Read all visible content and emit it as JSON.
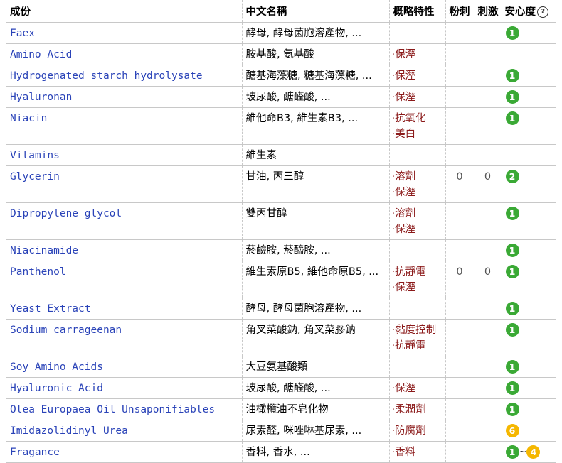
{
  "header": {
    "ingredient": "成份",
    "chinese": "中文名稱",
    "features": "概略特性",
    "acne": "粉刺",
    "irritation": "刺激",
    "safety": "安心度",
    "help_icon": "?"
  },
  "colors": {
    "green": "#3aa935",
    "orange": "#f5b700",
    "link": "#2a43b8",
    "feature": "#8b1a1a"
  },
  "rows": [
    {
      "name": "Faex",
      "cn": "酵母, 酵母菌胞溶產物, ...",
      "f": [
        "",
        ""
      ],
      "acne": "",
      "irr": "",
      "s1": "1",
      "s2": ""
    },
    {
      "name": "Amino Acid",
      "cn": "胺基酸, 氨基酸",
      "f": [
        "·保溼",
        ""
      ],
      "acne": "",
      "irr": "",
      "s1": "",
      "s2": ""
    },
    {
      "name": "Hydrogenated starch hydrolysate",
      "cn": "醣基海藻糖, 糖基海藻糖, ...",
      "f": [
        "·保溼",
        ""
      ],
      "acne": "",
      "irr": "",
      "s1": "1",
      "s2": ""
    },
    {
      "name": "Hyaluronan",
      "cn": "玻尿酸, 醣醛酸, ...",
      "f": [
        "·保溼",
        ""
      ],
      "acne": "",
      "irr": "",
      "s1": "1",
      "s2": ""
    },
    {
      "name": "Niacin",
      "cn": "維他命B3, 維生素B3, ...",
      "f": [
        "·抗氧化",
        "·美白"
      ],
      "acne": "",
      "irr": "",
      "s1": "1",
      "s2": ""
    },
    {
      "name": "Vitamins",
      "cn": "維生素",
      "f": [
        "",
        ""
      ],
      "acne": "",
      "irr": "",
      "s1": "",
      "s2": ""
    },
    {
      "name": "Glycerin",
      "cn": "甘油, 丙三醇",
      "f": [
        "·溶劑",
        "·保溼"
      ],
      "acne": "0",
      "irr": "0",
      "s1": "2",
      "s2": ""
    },
    {
      "name": "Dipropylene glycol",
      "cn": "雙丙甘醇",
      "f": [
        "·溶劑",
        "·保溼"
      ],
      "acne": "",
      "irr": "",
      "s1": "1",
      "s2": ""
    },
    {
      "name": "Niacinamide",
      "cn": "菸鹼胺, 菸醯胺, ...",
      "f": [
        "",
        ""
      ],
      "acne": "",
      "irr": "",
      "s1": "1",
      "s2": ""
    },
    {
      "name": "Panthenol",
      "cn": "維生素原B5, 維他命原B5, ...",
      "f": [
        "·抗靜電",
        "·保溼"
      ],
      "acne": "0",
      "irr": "0",
      "s1": "1",
      "s2": ""
    },
    {
      "name": "Yeast Extract",
      "cn": "酵母, 酵母菌胞溶產物, ...",
      "f": [
        "",
        ""
      ],
      "acne": "",
      "irr": "",
      "s1": "1",
      "s2": ""
    },
    {
      "name": "Sodium carrageenan",
      "cn": "角叉菜酸鈉, 角叉菜膠鈉",
      "f": [
        "·黏度控制",
        "·抗靜電"
      ],
      "acne": "",
      "irr": "",
      "s1": "1",
      "s2": ""
    },
    {
      "name": "Soy Amino Acids",
      "cn": "大豆氨基酸類",
      "f": [
        "",
        ""
      ],
      "acne": "",
      "irr": "",
      "s1": "1",
      "s2": ""
    },
    {
      "name": "Hyaluronic Acid",
      "cn": "玻尿酸, 醣醛酸, ...",
      "f": [
        "·保溼",
        ""
      ],
      "acne": "",
      "irr": "",
      "s1": "1",
      "s2": ""
    },
    {
      "name": "Olea Europaea Oil Unsaponifiables",
      "cn": "油橄欖油不皂化物",
      "f": [
        "·柔潤劑",
        ""
      ],
      "acne": "",
      "irr": "",
      "s1": "1",
      "s2": ""
    },
    {
      "name": "Imidazolidinyl Urea",
      "cn": "尿素醛, 咪唑啉基尿素, ...",
      "f": [
        "·防腐劑",
        ""
      ],
      "acne": "",
      "irr": "",
      "s1": "6",
      "s2": ""
    },
    {
      "name": "Fragance",
      "cn": "香料, 香水, ...",
      "f": [
        "·香料",
        ""
      ],
      "acne": "",
      "irr": "",
      "s1": "1",
      "s2": "4"
    }
  ]
}
